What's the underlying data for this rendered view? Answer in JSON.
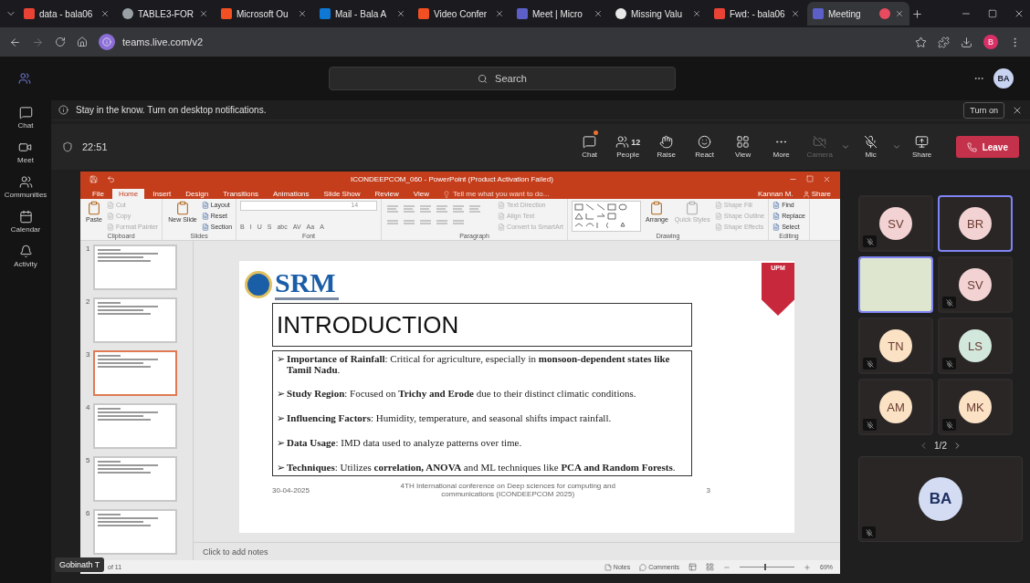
{
  "browser": {
    "tabs": [
      {
        "title": "data - bala06",
        "kind": "gmail",
        "selected": false
      },
      {
        "title": "TABLE3-FOR",
        "kind": "globe",
        "selected": false
      },
      {
        "title": "Microsoft Ou",
        "kind": "windows",
        "selected": false
      },
      {
        "title": "Mail - Bala A",
        "kind": "outlook",
        "selected": false
      },
      {
        "title": "Video Confer",
        "kind": "windows",
        "selected": false
      },
      {
        "title": "Meet | Micro",
        "kind": "teams",
        "selected": false
      },
      {
        "title": "Missing Valu",
        "kind": "circle",
        "selected": false
      },
      {
        "title": "Fwd: - bala06",
        "kind": "gmail",
        "selected": false
      },
      {
        "title": "Meeting",
        "kind": "teams",
        "selected": true,
        "recording": true
      }
    ],
    "address": "teams.live.com/v2",
    "profile": "B"
  },
  "teams": {
    "search": {
      "placeholder": "Search"
    },
    "avatar": "BA",
    "rail": [
      {
        "label": "Chat",
        "kind": "chat"
      },
      {
        "label": "Meet",
        "kind": "meet"
      },
      {
        "label": "Communities",
        "kind": "communities"
      },
      {
        "label": "Calendar",
        "kind": "calendar"
      },
      {
        "label": "Activity",
        "kind": "activity"
      }
    ]
  },
  "notification": {
    "text": "Stay in the know. Turn on desktop notifications.",
    "button": "Turn on"
  },
  "meeting": {
    "timer": "22:51",
    "controls": [
      {
        "label": "Chat",
        "kind": "chat",
        "unread": true
      },
      {
        "label": "People",
        "kind": "people",
        "count": "12"
      },
      {
        "label": "Raise",
        "kind": "raise"
      },
      {
        "label": "React",
        "kind": "react"
      },
      {
        "label": "View",
        "kind": "view"
      },
      {
        "label": "More",
        "kind": "more"
      },
      {
        "label": "Camera",
        "kind": "camera",
        "disabled": true,
        "dropdown": true
      },
      {
        "label": "Mic",
        "kind": "mic",
        "disabled": false,
        "dropdown": true
      },
      {
        "label": "Share",
        "kind": "share"
      }
    ],
    "leave": "Leave"
  },
  "powerpoint": {
    "title": "ICONDEEPCOM_060 - PowerPoint (Product Activation Failed)",
    "tabs": [
      {
        "label": "File",
        "selected": false
      },
      {
        "label": "Home",
        "selected": true
      },
      {
        "label": "Insert",
        "selected": false
      },
      {
        "label": "Design",
        "selected": false
      },
      {
        "label": "Transitions",
        "selected": false
      },
      {
        "label": "Animations",
        "selected": false
      },
      {
        "label": "Slide Show",
        "selected": false
      },
      {
        "label": "Review",
        "selected": false
      },
      {
        "label": "View",
        "selected": false
      }
    ],
    "tell_me": "Tell me what you want to do...",
    "user": "Kannan M.",
    "share": "Share",
    "groups": [
      {
        "label": "Clipboard",
        "columns": [
          [
            {
              "kind": "large",
              "label": "Paste",
              "disabled": false
            }
          ],
          [
            {
              "kind": "small",
              "label": "Cut",
              "disabled": true
            },
            {
              "kind": "small",
              "label": "Copy",
              "disabled": true
            },
            {
              "kind": "small",
              "label": "Format Painter",
              "disabled": true
            }
          ]
        ]
      },
      {
        "label": "Slides",
        "columns": [
          [
            {
              "kind": "large",
              "label": "New Slide",
              "disabled": false
            }
          ],
          [
            {
              "kind": "small",
              "label": "Layout",
              "disabled": false
            },
            {
              "kind": "small",
              "label": "Reset",
              "disabled": false
            },
            {
              "kind": "small",
              "label": "Section",
              "disabled": false
            }
          ]
        ]
      },
      {
        "label": "Font",
        "columns": [
          [
            {
              "kind": "field",
              "value": "14"
            },
            {
              "kind": "glyphs",
              "glyphs": [
                "B",
                "I",
                "U",
                "S",
                "abc",
                "AV",
                "Aa",
                "A"
              ]
            }
          ]
        ]
      },
      {
        "label": "Paragraph",
        "columns": [
          [
            {
              "kind": "icons"
            }
          ],
          [
            {
              "kind": "small",
              "label": "Text Direction",
              "disabled": true
            },
            {
              "kind": "small",
              "label": "Align Text",
              "disabled": true
            },
            {
              "kind": "small",
              "label": "Convert to SmartArt",
              "disabled": true
            }
          ]
        ]
      },
      {
        "label": "Drawing",
        "columns": [
          [
            {
              "kind": "gallery"
            }
          ],
          [
            {
              "kind": "large",
              "label": "Arrange",
              "disabled": false
            }
          ],
          [
            {
              "kind": "large",
              "label": "Quick Styles",
              "disabled": true
            }
          ],
          [
            {
              "kind": "small",
              "label": "Shape Fill",
              "disabled": true
            },
            {
              "kind": "small",
              "label": "Shape Outline",
              "disabled": true
            },
            {
              "kind": "small",
              "label": "Shape Effects",
              "disabled": true
            }
          ]
        ]
      },
      {
        "label": "Editing",
        "columns": [
          [
            {
              "kind": "small",
              "label": "Find",
              "disabled": false
            },
            {
              "kind": "small",
              "label": "Replace",
              "disabled": false
            },
            {
              "kind": "small",
              "label": "Select",
              "disabled": false
            }
          ]
        ]
      }
    ],
    "thumbnails": [
      {
        "number": "1",
        "selected": false
      },
      {
        "number": "2",
        "selected": false
      },
      {
        "number": "3",
        "selected": true
      },
      {
        "number": "4",
        "selected": false
      },
      {
        "number": "5",
        "selected": false
      },
      {
        "number": "6",
        "selected": false
      }
    ],
    "slide": {
      "logo": "SRM",
      "badge": "UPM",
      "title": "INTRODUCTION",
      "bullets": [
        {
          "marker": "➢",
          "text": "**Importance of Rainfall**: Critical for agriculture, especially in **monsoon-dependent states like Tamil Nadu**."
        },
        {
          "marker": "➢",
          "text": "**Study Region**: Focused on **Trichy and Erode** due to their distinct climatic conditions."
        },
        {
          "marker": "➢",
          "text": "**Influencing Factors**: Humidity, temperature, and seasonal shifts impact rainfall."
        },
        {
          "marker": "➢",
          "text": "**Data Usage**: IMD data used to analyze patterns over time."
        },
        {
          "marker": "➢",
          "text": "**Techniques**: Utilizes **correlation, ANOVA** and ML techniques like **PCA and Random Forests**."
        }
      ],
      "date": "30-04-2025",
      "footer": "4TH International conference on Deep sciences for computing and communications  (ICONDEEPCOM 2025)",
      "page": "3"
    },
    "notes_placeholder": "Click to add notes",
    "status": {
      "slide_count": "of 11",
      "notes": "Notes",
      "comments": "Comments",
      "zoom": "69%",
      "level": 0.45
    }
  },
  "presenter": "Gobinath T",
  "participants": [
    {
      "kind": "avatar",
      "initials": "SV",
      "color": "#f2d2d2",
      "muted": true,
      "speaking": false
    },
    {
      "kind": "avatar",
      "initials": "BR",
      "color": "#f2d2d2",
      "muted": false,
      "speaking": true
    },
    {
      "kind": "video",
      "speaking": true
    },
    {
      "kind": "avatar",
      "initials": "SV",
      "color": "#f2d2d2",
      "muted": true,
      "speaking": false
    },
    {
      "kind": "avatar",
      "initials": "TN",
      "color": "#fbe2c4",
      "muted": true,
      "speaking": false
    },
    {
      "kind": "avatar",
      "initials": "LS",
      "color": "#d3e8dc",
      "muted": true,
      "speaking": false
    },
    {
      "kind": "avatar",
      "initials": "AM",
      "color": "#fbe2c4",
      "muted": true,
      "speaking": false
    },
    {
      "kind": "avatar",
      "initials": "MK",
      "color": "#fbe2c4",
      "muted": true,
      "speaking": false
    }
  ],
  "pager": "1/2",
  "self": {
    "initials": "BA",
    "color": "#d3dcf2",
    "muted": true
  }
}
